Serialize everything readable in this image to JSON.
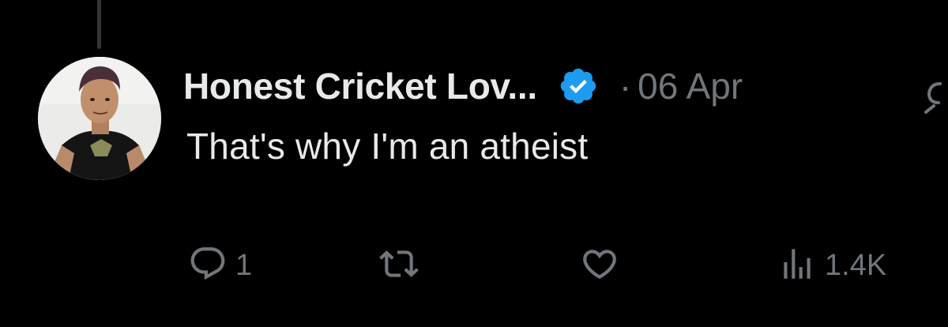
{
  "tweet": {
    "display_name": "Honest Cricket Lov...",
    "separator": "·",
    "date": "06 Apr",
    "text": "That's why I'm an atheist",
    "verified_icon": "verified-badge-icon"
  },
  "actions": {
    "reply": {
      "icon": "reply-icon",
      "count": "1"
    },
    "retweet": {
      "icon": "retweet-icon",
      "count": ""
    },
    "like": {
      "icon": "heart-icon",
      "count": ""
    },
    "views": {
      "icon": "views-icon",
      "count": "1.4K"
    }
  },
  "colors": {
    "background": "#000000",
    "primary_text": "#e7e9ea",
    "secondary_text": "#71767b",
    "verified_blue": "#1d9bf0",
    "thread_line": "#333639"
  }
}
